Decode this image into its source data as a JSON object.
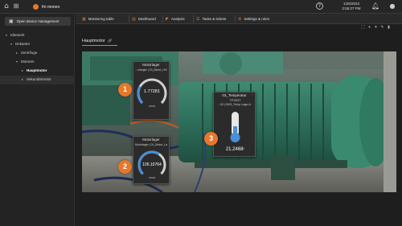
{
  "topbar": {
    "brand": "fm moneo",
    "clock_date": "1/26/2023",
    "clock_time": "2:55:27 PM",
    "icons": [
      "home-icon",
      "sitemap-icon",
      "help-icon",
      "bell-icon",
      "user-icon"
    ]
  },
  "sidebar": {
    "open_button": "Open device management",
    "tree": [
      {
        "label": "Klärwerk",
        "level": 0
      },
      {
        "label": "Dekanter",
        "level": 1
      },
      {
        "label": "Zentrifuge",
        "level": 2
      },
      {
        "label": "Motoren",
        "level": 2
      },
      {
        "label": "Hauptmotor",
        "level": 3,
        "active": true
      },
      {
        "label": "Sekundärmotor",
        "level": 3
      }
    ]
  },
  "tabs": [
    {
      "label": "Monitoring table",
      "icon": "table-icon"
    },
    {
      "label": "Dashboard",
      "icon": "dashboard-icon"
    },
    {
      "label": "Analysis",
      "icon": "chart-icon"
    },
    {
      "label": "Tasks & tickets",
      "icon": "tasks-icon"
    },
    {
      "label": "Settings & rules",
      "icon": "settings-icon"
    }
  ],
  "page": {
    "title": "Hauptmotor"
  },
  "widgets": {
    "gauge1": {
      "title": "Motorlager",
      "subtitle": "...ortlager | 03_Motor_HVZ0001",
      "value": "1.77281",
      "unit": "mm/s",
      "fill": 0.28
    },
    "gauge2": {
      "title": "Motorlager",
      "subtitle": "Motorlager | 01_Motor_Lager",
      "value": "105.10764",
      "unit": "mm/s",
      "fill": 0.62
    },
    "thermo": {
      "title": "03_Temperatur",
      "tag": "TP3237",
      "subtitle": "...03 | 0003_Temp Lager A",
      "value": "21.2468",
      "unit": "°",
      "fill": 0.3
    }
  },
  "badges": [
    "1",
    "2",
    "3"
  ],
  "colors": {
    "accent": "#e8772a",
    "gauge_fill": "#4a8fd8",
    "widget_bg": "#2b2b2b"
  }
}
